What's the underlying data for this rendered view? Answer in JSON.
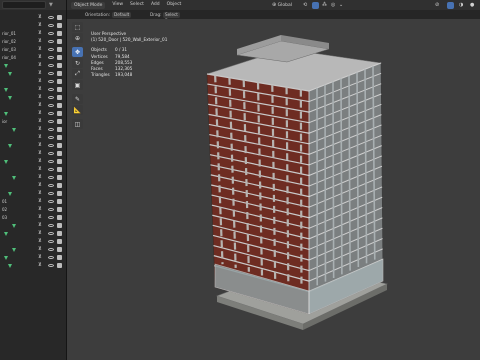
{
  "outliner": {
    "rows": [
      {
        "label": "",
        "tri": false
      },
      {
        "label": "",
        "tri": false
      },
      {
        "label": "rior_01",
        "tri": false
      },
      {
        "label": "rior_02",
        "tri": false
      },
      {
        "label": "rior_03",
        "tri": false
      },
      {
        "label": "rior_04",
        "tri": false
      },
      {
        "label": "",
        "tri": true
      },
      {
        "label": "",
        "tri": true
      },
      {
        "label": "",
        "tri": false
      },
      {
        "label": "",
        "tri": true
      },
      {
        "label": "",
        "tri": true
      },
      {
        "label": "",
        "tri": false
      },
      {
        "label": "",
        "tri": true
      },
      {
        "label": "ior",
        "tri": false
      },
      {
        "label": "",
        "tri": true
      },
      {
        "label": "",
        "tri": false
      },
      {
        "label": "",
        "tri": true
      },
      {
        "label": "",
        "tri": false
      },
      {
        "label": "",
        "tri": true
      },
      {
        "label": "",
        "tri": false
      },
      {
        "label": "",
        "tri": true
      },
      {
        "label": "",
        "tri": false
      },
      {
        "label": "",
        "tri": true
      },
      {
        "label": "01",
        "tri": false
      },
      {
        "label": "02",
        "tri": false
      },
      {
        "label": "03",
        "tri": false
      },
      {
        "label": "",
        "tri": true
      },
      {
        "label": "",
        "tri": true
      },
      {
        "label": "",
        "tri": false
      },
      {
        "label": "",
        "tri": true
      },
      {
        "label": "",
        "tri": true
      },
      {
        "label": "",
        "tri": true
      }
    ]
  },
  "header": {
    "mode": "Object Mode",
    "menu": [
      "View",
      "Select",
      "Add",
      "Object"
    ],
    "transform": "Global"
  },
  "tool_settings": {
    "orientation_label": "Orientation:",
    "orientation_value": "Default",
    "drag_label": "Drag:",
    "drag_value": "Select Box"
  },
  "toolbar": {
    "tools": [
      {
        "name": "select-tool",
        "glyph": "⬚",
        "active": false
      },
      {
        "name": "cursor-tool",
        "glyph": "⊕",
        "active": false
      },
      {
        "name": "move-tool",
        "glyph": "✥",
        "active": true
      },
      {
        "name": "rotate-tool",
        "glyph": "↻",
        "active": false
      },
      {
        "name": "scale-tool",
        "glyph": "⤢",
        "active": false
      },
      {
        "name": "transform-tool",
        "glyph": "▣",
        "active": false
      },
      {
        "name": "annotate-tool",
        "glyph": "✎",
        "active": false
      },
      {
        "name": "measure-tool",
        "glyph": "📐",
        "active": false
      },
      {
        "name": "add-cube-tool",
        "glyph": "◫",
        "active": false
      }
    ]
  },
  "viewport": {
    "perspective": "User Perspective",
    "selection": "(1) 520_Door | 520_Wall_Exterior_01",
    "stats": [
      {
        "label": "Objects",
        "value": "0 / 31"
      },
      {
        "label": "Vertices",
        "value": "79,584"
      },
      {
        "label": "Edges",
        "value": "208,553"
      },
      {
        "label": "Faces",
        "value": "132,305"
      },
      {
        "label": "Triangles",
        "value": "193,048"
      }
    ]
  },
  "colors": {
    "accent": "#4772b3",
    "brick": "#6e2c22",
    "slab": "#c9c9c9",
    "glass": "#8f9ea0",
    "collection": "#4fbf7a"
  }
}
